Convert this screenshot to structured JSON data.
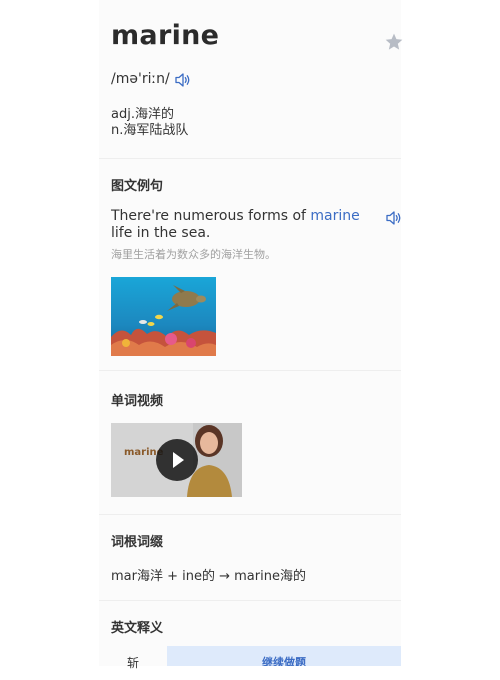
{
  "entry": {
    "word": "marine",
    "phonetic": "/mə'riːn/",
    "definitions": [
      "adj.海洋的",
      "n.海军陆战队"
    ]
  },
  "sections": {
    "examples_title": "图文例句",
    "video_title": "单词视频",
    "roots_title": "词根词缀",
    "english_title": "英文释义"
  },
  "example": {
    "before": "There're numerous forms of ",
    "highlight": "marine",
    "after": " life in the sea.",
    "translation": "海里生活着为数众多的海洋生物。"
  },
  "video": {
    "overlay_word": "marine"
  },
  "roots": {
    "formula": "mar海洋 + ine的 → marine海的"
  },
  "bottom_bar": {
    "left_label": "斩",
    "continue_label": "继续做题"
  },
  "colors": {
    "accent": "#3b6cc4",
    "panel_bg": "#fbfbfb",
    "button_bg": "#deeafb",
    "muted_text": "#a0a0a0"
  }
}
